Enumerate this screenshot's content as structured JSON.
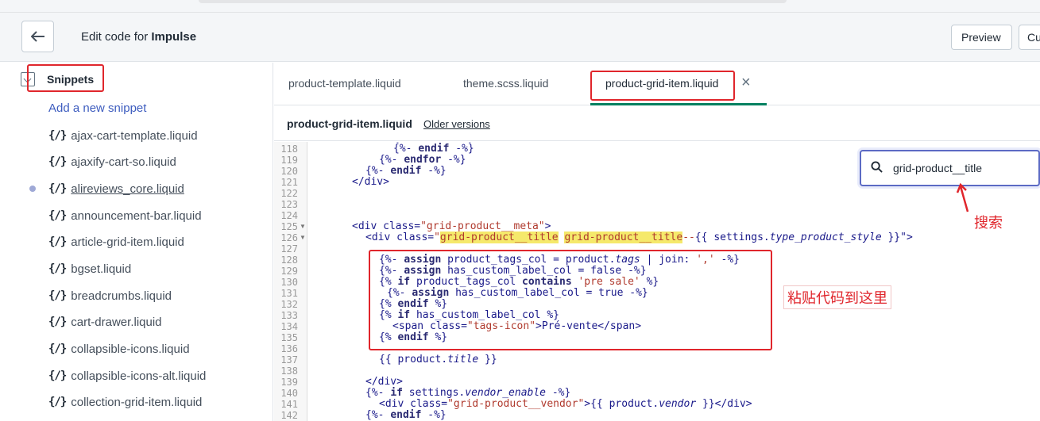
{
  "header": {
    "title_prefix": "Edit code for ",
    "title_theme": "Impulse",
    "preview_label": "Preview",
    "customize_label": "Cu"
  },
  "sidebar": {
    "section_label": "Snippets",
    "add_label": "Add a new snippet",
    "items": [
      {
        "icon": "{/}",
        "label": "ajax-cart-template.liquid"
      },
      {
        "icon": "{/}",
        "label": "ajaxify-cart-so.liquid"
      },
      {
        "icon": "{/}",
        "label": "alireviews_core.liquid"
      },
      {
        "icon": "{/}",
        "label": "announcement-bar.liquid"
      },
      {
        "icon": "{/}",
        "label": "article-grid-item.liquid"
      },
      {
        "icon": "{/}",
        "label": "bgset.liquid"
      },
      {
        "icon": "{/}",
        "label": "breadcrumbs.liquid"
      },
      {
        "icon": "{/}",
        "label": "cart-drawer.liquid"
      },
      {
        "icon": "{/}",
        "label": "collapsible-icons.liquid"
      },
      {
        "icon": "{/}",
        "label": "collapsible-icons-alt.liquid"
      },
      {
        "icon": "{/}",
        "label": "collection-grid-item.liquid"
      }
    ]
  },
  "tabs": [
    {
      "label": "product-template.liquid"
    },
    {
      "label": "theme.scss.liquid"
    },
    {
      "label": "product-grid-item.liquid"
    }
  ],
  "file_bar": {
    "file_name": "product-grid-item.liquid",
    "older_versions": "Older versions"
  },
  "editor": {
    "line_numbers": [
      "118",
      "119",
      "120",
      "121",
      "122",
      "123",
      "124",
      "125",
      "126",
      "127",
      "128",
      "129",
      "130",
      "131",
      "132",
      "133",
      "134",
      "135",
      "136",
      "137",
      "138",
      "139",
      "140",
      "141",
      "142"
    ]
  },
  "search": {
    "value": "grid-product__title"
  },
  "annotations": {
    "search_note": "搜索",
    "paste_note": "粘贴代码到这里"
  },
  "colors": {
    "accent": "#5c6ac4",
    "active_tab": "#008060",
    "annotation_red": "#e0262c",
    "highlight": "#f5e96b"
  }
}
